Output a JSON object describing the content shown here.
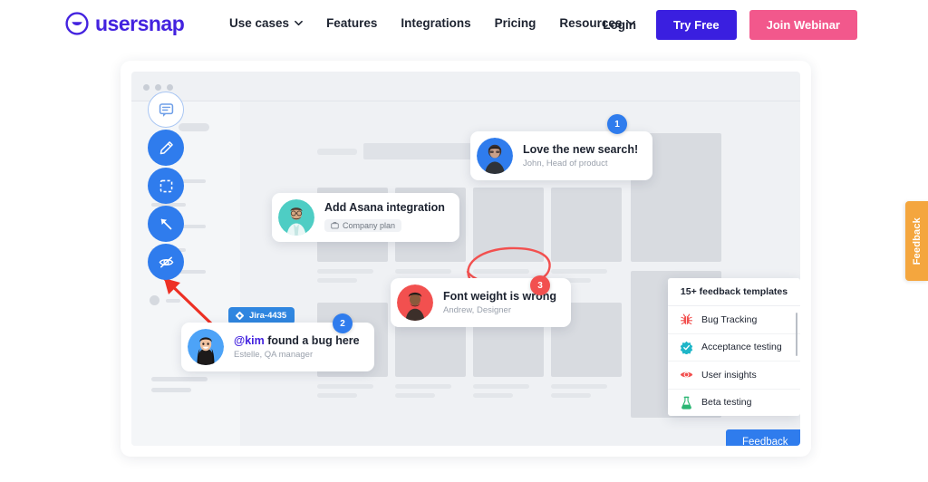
{
  "header": {
    "brand": "usersnap",
    "logo_icon": "usersnap-smile-logo",
    "nav": [
      {
        "label": "Use cases",
        "has_caret": true
      },
      {
        "label": "Features",
        "has_caret": false
      },
      {
        "label": "Integrations",
        "has_caret": false
      },
      {
        "label": "Pricing",
        "has_caret": false
      },
      {
        "label": "Resources",
        "has_caret": true
      }
    ],
    "login_label": "Login",
    "try_free_label": "Try Free",
    "join_webinar_label": "Join Webinar",
    "colors": {
      "brand_purple": "#4322df",
      "try_free_bg": "#3a1fe0",
      "webinar_bg": "#f2588c",
      "nav_text": "#1d2330"
    }
  },
  "mockup": {
    "toolbar": [
      {
        "icon": "comment-icon",
        "style": "white"
      },
      {
        "icon": "pencil-icon",
        "style": "blue"
      },
      {
        "icon": "screenshot-frame-icon",
        "style": "blue"
      },
      {
        "icon": "arrow-pointer-icon",
        "style": "blue"
      },
      {
        "icon": "eye-off-icon",
        "style": "blue"
      }
    ],
    "feedback_cards": [
      {
        "id": "love-the-new-search",
        "title": "Love the new search!",
        "subtitle": "John, Head of product",
        "badge": "1",
        "badge_color": "#2f7ced",
        "avatar_color": "#2f7ced"
      },
      {
        "id": "add-asana-integration",
        "title": "Add Asana integration",
        "subtitle": "",
        "chip_label": "Company plan",
        "chip_icon": "briefcase-icon",
        "avatar_color": "#4ecdc4"
      },
      {
        "id": "font-weight-is-wrong",
        "title": "Font weight is wrong",
        "subtitle": "Andrew, Designer",
        "badge": "3",
        "badge_color": "#f2504f",
        "avatar_color": "#f2504f"
      },
      {
        "id": "kim-found-a-bug-here",
        "title_mention": "@kim",
        "title_rest": " found a bug here",
        "subtitle": "Estelle, QA manager",
        "badge": "2",
        "badge_color": "#2f7ced",
        "tag_label": "Jira-4435",
        "tag_icon": "jira-icon",
        "avatar_color": "#4da3f7"
      }
    ],
    "templates_panel": {
      "heading": "15+ feedback templates",
      "items": [
        {
          "label": "Bug Tracking",
          "icon": "bug-icon",
          "color": "#f2504f"
        },
        {
          "label": "Acceptance testing",
          "icon": "check-badge-icon",
          "color": "#1fb6c8"
        },
        {
          "label": "User insights",
          "icon": "eye-icon",
          "color": "#f2504f"
        },
        {
          "label": "Beta testing",
          "icon": "flask-icon",
          "color": "#2bb673"
        }
      ]
    },
    "feedback_button_label": "Feedback",
    "annotation": {
      "type": "red-circle-scribble",
      "color": "#f2504f"
    },
    "arrow": {
      "type": "red-arrow",
      "color": "#ed3024"
    }
  },
  "side_tab": {
    "label": "Feedback",
    "color": "#f4a63e"
  }
}
